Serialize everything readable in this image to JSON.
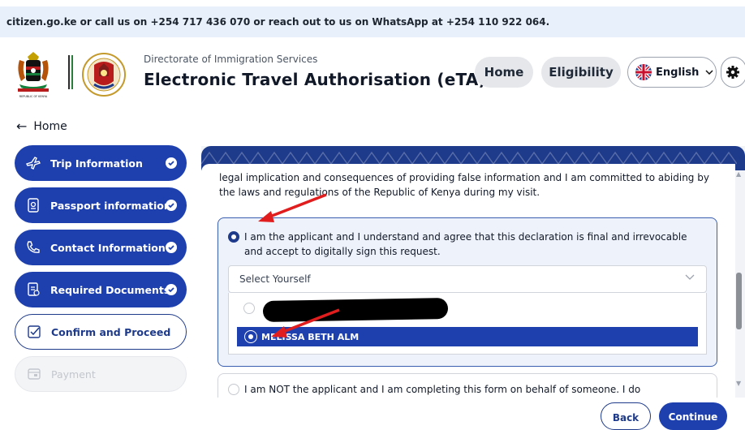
{
  "banner": {
    "text": "citizen.go.ke or call us on +254 717 436 070 or reach out to us on WhatsApp at +254 110 922 064."
  },
  "header": {
    "subtitle": "Directorate of Immigration Services",
    "title": "Electronic Travel Authorisation (eTA)",
    "coat_caption": "REPUBLIC OF KENYA",
    "nav": {
      "home": "Home",
      "eligibility": "Eligibility"
    },
    "language": "English"
  },
  "back_link": "Home",
  "steps": [
    {
      "label": "Trip Information",
      "icon": "plane-icon",
      "state": "done"
    },
    {
      "label": "Passport information",
      "icon": "passport-icon",
      "state": "done"
    },
    {
      "label": "Contact Information",
      "icon": "phone-icon",
      "state": "done"
    },
    {
      "label": "Required Documents",
      "icon": "documents-icon",
      "state": "done"
    },
    {
      "label": "Confirm and Proceed",
      "icon": "checkbox-icon",
      "state": "current"
    },
    {
      "label": "Payment",
      "icon": "payment-icon",
      "state": "disabled"
    }
  ],
  "declaration": {
    "intro": "legal implication and consequences of providing false information and I am committed to abiding by the laws and regulations of the Republic of Kenya during my visit.",
    "option_applicant": "I am the applicant and I understand and agree that this declaration is final and irrevocable and accept to digitally sign this request.",
    "option_applicant_selected": true,
    "select_placeholder": "Select Yourself",
    "selected_person": "MELISSA BETH ALM",
    "option_not_applicant": "I am NOT the applicant and I am completing this form on behalf of someone. I do"
  },
  "buttons": {
    "back": "Back",
    "continue": "Continue"
  },
  "colors": {
    "primary": "#1e40af",
    "banner_bg": "#e8f0fb",
    "annotation_red": "#e11d1d"
  }
}
